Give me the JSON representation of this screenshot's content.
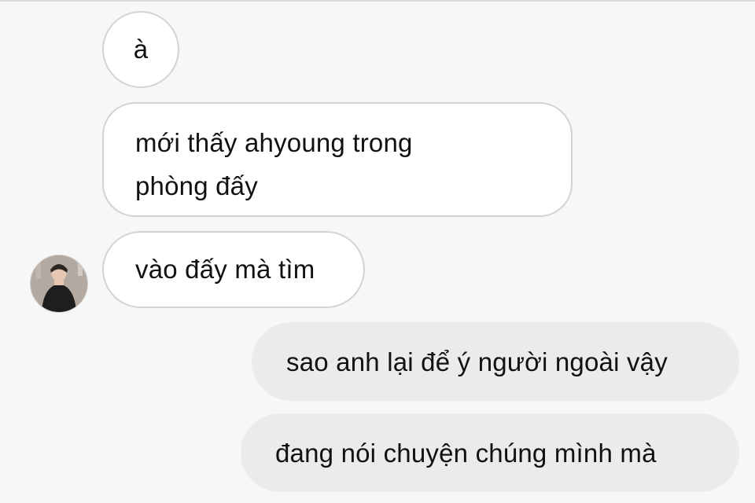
{
  "conversation": {
    "messages": [
      {
        "sender": "other",
        "text": "à"
      },
      {
        "sender": "other",
        "lines": [
          "mới thấy ahyoung trong",
          "phòng đấy"
        ]
      },
      {
        "sender": "other",
        "text": "vào đấy mà tìm"
      },
      {
        "sender": "me",
        "text": "sao anh lại để ý người ngoài vậy"
      },
      {
        "sender": "me",
        "text": "đang nói chuyện chúng mình mà"
      }
    ]
  },
  "colors": {
    "background": "#f7f7f7",
    "incoming_bubble": "#ffffff",
    "incoming_border": "#d3d3d3",
    "outgoing_bubble": "#ebebeb",
    "text": "#111111"
  },
  "icons": {
    "avatar": "user-avatar-photo"
  }
}
